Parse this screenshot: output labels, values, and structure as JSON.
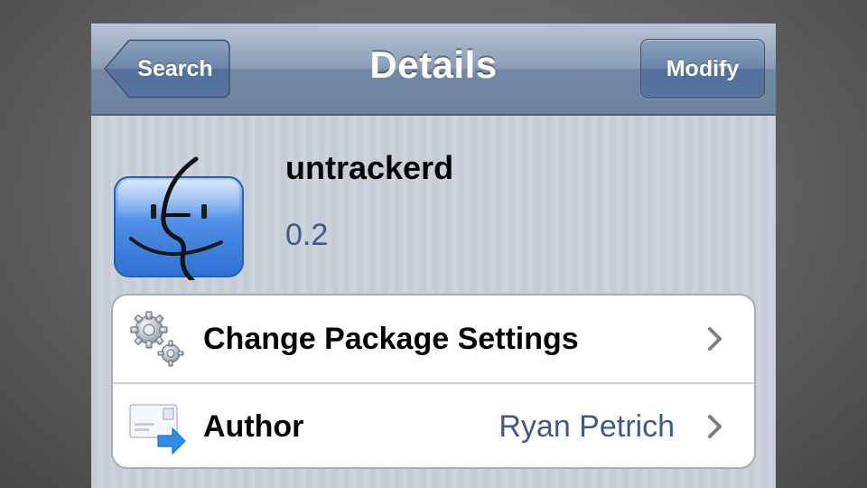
{
  "navbar": {
    "back_label": "Search",
    "title": "Details",
    "right_label": "Modify"
  },
  "package": {
    "name": "untrackerd",
    "version": "0.2",
    "icon": "finder-face-icon"
  },
  "rows": [
    {
      "label": "Change Package Settings",
      "icon": "gears-icon",
      "value": ""
    },
    {
      "label": "Author",
      "icon": "mail-author-icon",
      "value": "Ryan Petrich"
    }
  ],
  "colors": {
    "navbar": "#7388a4",
    "background": "#c5ccd4",
    "value_text": "#3e5a86"
  }
}
